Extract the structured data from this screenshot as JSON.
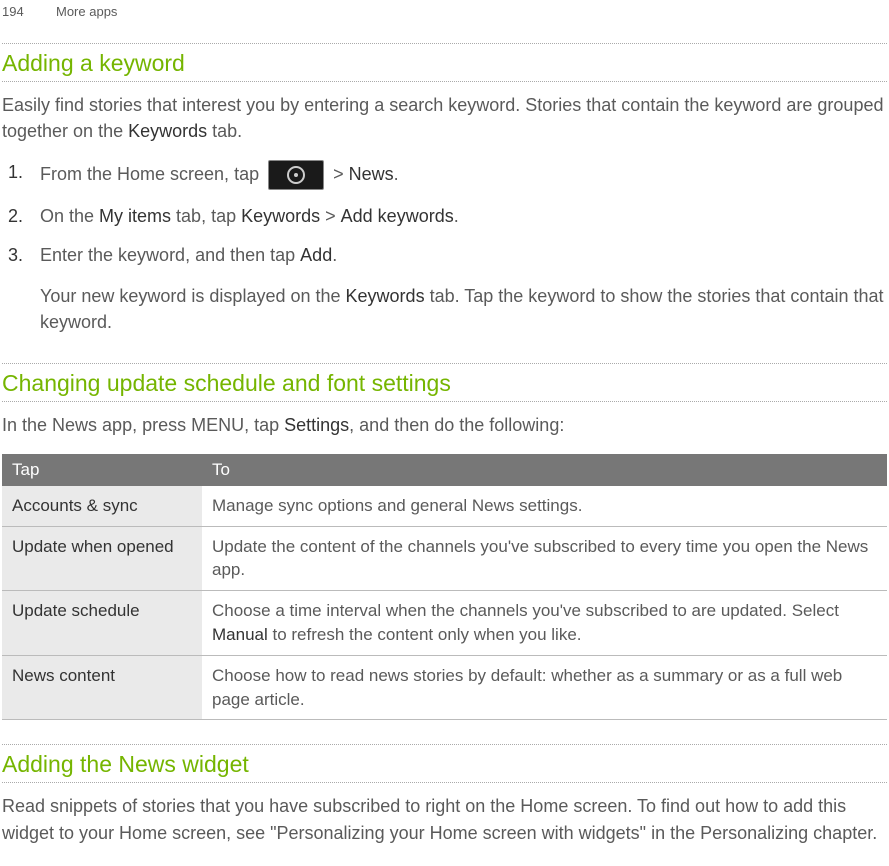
{
  "header": {
    "page": "194",
    "section": "More apps"
  },
  "section1": {
    "title": "Adding a keyword",
    "intro_a": "Easily find stories that interest you by entering a search keyword. Stories that contain the keyword are grouped together on the ",
    "intro_bold": "Keywords",
    "intro_b": " tab.",
    "steps": {
      "s1_a": "From the Home screen, tap ",
      "s1_b": " > ",
      "s1_bold": "News",
      "s1_c": ".",
      "s2_a": "On the ",
      "s2_b1": "My items",
      "s2_c": " tab, tap ",
      "s2_b2": "Keywords",
      "s2_d": " > ",
      "s2_b3": "Add keywords",
      "s2_e": ".",
      "s3_a": "Enter the keyword, and then tap ",
      "s3_bold": "Add",
      "s3_b": "."
    },
    "result_a": "Your new keyword is displayed on the ",
    "result_bold": "Keywords",
    "result_b": " tab. Tap the keyword to show the stories that contain that keyword."
  },
  "section2": {
    "title": "Changing update schedule and font settings",
    "intro_a": "In the News app, press MENU, tap ",
    "intro_bold": "Settings",
    "intro_b": ", and then do the following:",
    "table": {
      "head_tap": "Tap",
      "head_to": "To",
      "rows": [
        {
          "tap": "Accounts & sync",
          "to": "Manage sync options and general News settings."
        },
        {
          "tap": "Update when opened",
          "to": "Update the content of the channels you've subscribed to every time you open the News app."
        },
        {
          "tap": "Update schedule",
          "to_a": "Choose a time interval when the channels you've subscribed to are updated. Select ",
          "to_bold": "Manual",
          "to_b": " to refresh the content only when you like."
        },
        {
          "tap": "News content",
          "to": "Choose how to read news stories by default: whether as a summary or as a full web page article."
        }
      ]
    }
  },
  "section3": {
    "title": "Adding the News widget",
    "body": "Read snippets of stories that you have subscribed to right on the Home screen. To find out how to add this widget to your Home screen, see \"Personalizing your Home screen with widgets\" in the Personalizing chapter."
  }
}
